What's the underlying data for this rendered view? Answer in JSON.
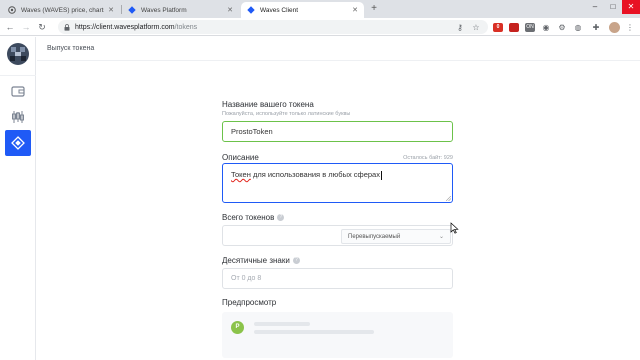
{
  "browser": {
    "tabs": [
      {
        "title": "Waves (WAVES) price, charts, mark",
        "active": false
      },
      {
        "title": "Waves Platform",
        "active": false
      },
      {
        "title": "Waves Client",
        "active": true
      }
    ],
    "new_tab": "+",
    "url_host": "https://client.wavesplatform.com",
    "url_path": "/tokens",
    "extension_badge_count": "0",
    "extension_badge_gray": "ON"
  },
  "app": {
    "page_title": "Выпуск токена",
    "sidebar": [
      "wallet-icon",
      "dex-icon",
      "tokens-icon"
    ],
    "active_sidebar": "tokens-icon",
    "accent": "#1f5af6",
    "valid": "#6cc24a"
  },
  "form": {
    "name_label": "Название вашего токена",
    "name_hint": "Пожалуйста, используйте только латинские буквы",
    "name_value": "ProstoToken",
    "desc_label": "Описание",
    "desc_remaining": "Осталось байт: 929",
    "desc_word1": "Токен",
    "desc_rest": " для использования в любых сферах",
    "total_label": "Всего токенов",
    "total_value": "",
    "reissuable": "Перевыпускаемый",
    "decimals_label": "Десятичные знаки",
    "decimals_placeholder": "От 0 до 8",
    "preview_label": "Предпросмотр",
    "preview_letter": "P"
  }
}
